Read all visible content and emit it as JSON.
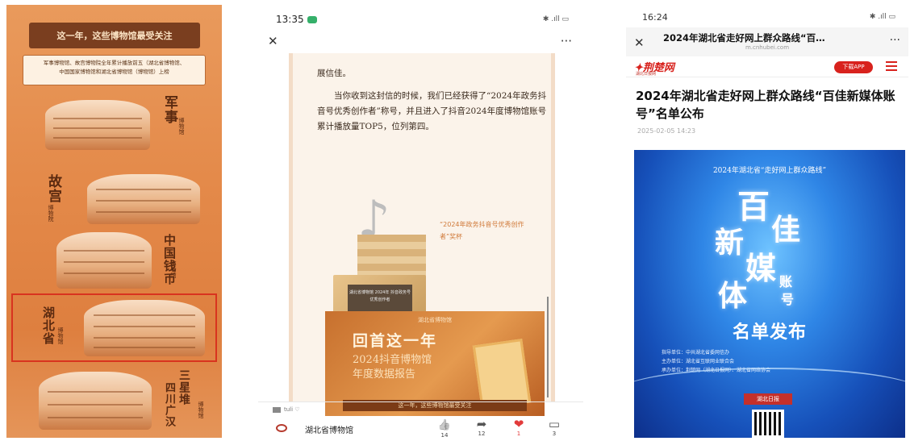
{
  "panel1": {
    "banner": "这一年，这些博物馆最受关注",
    "note_line1": "军事博物馆、故宫博物院全年累计播放前五（湖北省博物馆、",
    "note_line2": "中国国家博物馆和湖北省博物馆（博物馆）上榜",
    "label_military": "军事",
    "sub_military": "博物馆",
    "label_palace": "故宫",
    "sub_palace": "博物院",
    "label_coin": "中国钱币",
    "sub_coin": "博物馆",
    "label_hubei": "湖北省",
    "sub_hubei": "博物馆",
    "label_sxd": "三星堆",
    "label_sxd2": "四川广汉",
    "sub_sxd": "博物馆"
  },
  "panel2": {
    "time": "13:35",
    "status_right": "✱ .ıll ▭",
    "close": "✕",
    "more": "···",
    "para1": "展信佳。",
    "para2": "当你收到这封信的时候，我们已经获得了“2024年政务抖音号优秀创作者”称号，并且进入了抖音2024年度博物馆账号累计播放量TOP5，位列第四。",
    "plate_text": "湖北省博物馆 2024年 抖音政务号优秀创作者",
    "award_text": "“2024年政务抖音号优秀创作者”奖杯",
    "report_top": "湖北省博物馆",
    "report_title": "回首这一年",
    "report_sub1": "2024抖音博物馆",
    "report_sub2": "年度数据报告",
    "report_bar": "这一年，这些博物馆最受关注",
    "tiny_text": "tuli ♡",
    "account_name": "湖北省博物馆",
    "likes_icon": "👍",
    "likes": "14",
    "share_icon": "➦",
    "shares": "12",
    "heart_icon": "❤",
    "hearts": "1",
    "comment_icon": "▭",
    "comments": "3"
  },
  "panel3": {
    "time": "16:24",
    "status_right": "✱ .ıll ▭",
    "close": "✕",
    "title": "2024年湖北省走好网上群众路线“百…",
    "url": "m.cnhubei.com",
    "more": "···",
    "site_logo": "✦荆楚网",
    "site_tag": "湖北日报网",
    "download": "下载APP",
    "headline": "2024年湖北省走好网上群众路线“百佳新媒体账号”名单公布",
    "date": "2025-02-05 14:23",
    "poster_title": "2024年湖北省“走好网上群众路线”",
    "cal_bai": "百",
    "cal_jia": "佳",
    "cal_xin": "新",
    "cal_mei": "媒",
    "cal_ti": "体",
    "cal_zhang": "账",
    "cal_hao": "号",
    "mingdan": "名单发布",
    "org1": "指导单位：中共湖北省委网信办",
    "org2": "主办单位：湖北省互联网业联合会",
    "org3": "承办单位：荆楚网（湖北日报网）、湖北省网络协会",
    "logo": "湖北日报",
    "accent": "#d8221d"
  }
}
